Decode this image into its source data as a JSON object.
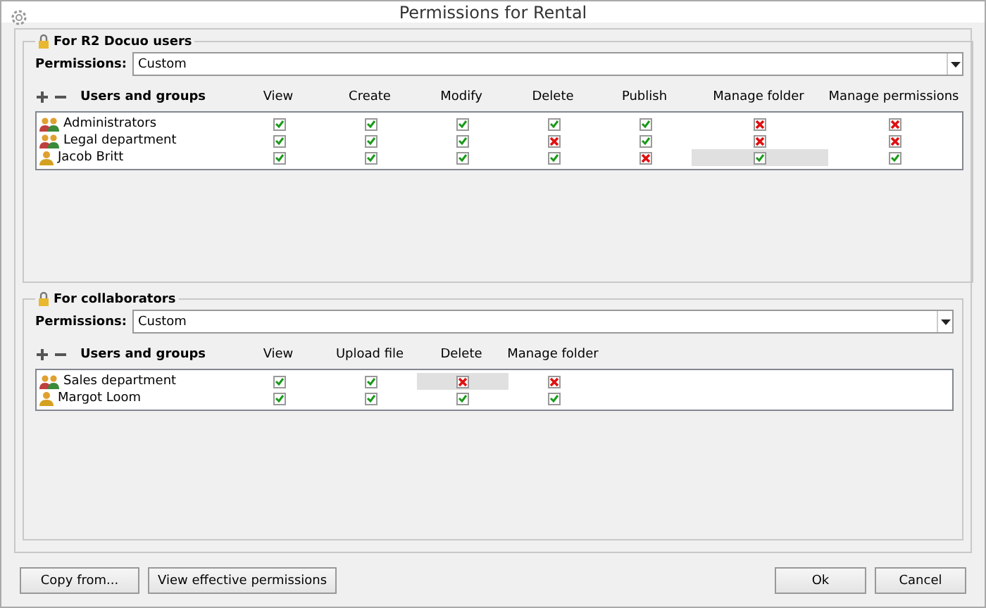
{
  "window": {
    "title": "Permissions for Rental"
  },
  "sections": [
    {
      "title": "For R2 Docuo users",
      "permissions_label": "Permissions:",
      "permissions_value": "Custom",
      "name_header": "Users and groups",
      "columns": [
        "View",
        "Create",
        "Modify",
        "Delete",
        "Publish",
        "Manage folder",
        "Manage permissions"
      ],
      "rows": [
        {
          "name": "Administrators",
          "kind": "group",
          "cells": [
            {
              "kind": "granted",
              "selected": false
            },
            {
              "kind": "granted",
              "selected": false
            },
            {
              "kind": "granted",
              "selected": false
            },
            {
              "kind": "granted",
              "selected": false
            },
            {
              "kind": "granted",
              "selected": false
            },
            {
              "kind": "denied",
              "selected": false
            },
            {
              "kind": "denied",
              "selected": false
            }
          ]
        },
        {
          "name": "Legal department",
          "kind": "group",
          "cells": [
            {
              "kind": "granted",
              "selected": false
            },
            {
              "kind": "granted",
              "selected": false
            },
            {
              "kind": "granted",
              "selected": false
            },
            {
              "kind": "denied",
              "selected": false
            },
            {
              "kind": "granted",
              "selected": false
            },
            {
              "kind": "denied",
              "selected": false
            },
            {
              "kind": "denied",
              "selected": false
            }
          ]
        },
        {
          "name": "Jacob Britt",
          "kind": "user",
          "cells": [
            {
              "kind": "granted",
              "selected": false
            },
            {
              "kind": "granted",
              "selected": false
            },
            {
              "kind": "granted",
              "selected": false
            },
            {
              "kind": "granted",
              "selected": false
            },
            {
              "kind": "denied",
              "selected": false
            },
            {
              "kind": "granted",
              "selected": true
            },
            {
              "kind": "granted",
              "selected": false
            }
          ]
        }
      ]
    },
    {
      "title": "For collaborators",
      "permissions_label": "Permissions:",
      "permissions_value": "Custom",
      "name_header": "Users and groups",
      "columns": [
        "View",
        "Upload file",
        "Delete",
        "Manage folder"
      ],
      "rows": [
        {
          "name": "Sales department",
          "kind": "group",
          "cells": [
            {
              "kind": "granted",
              "selected": false
            },
            {
              "kind": "granted",
              "selected": false
            },
            {
              "kind": "denied",
              "selected": true
            },
            {
              "kind": "denied",
              "selected": false
            }
          ]
        },
        {
          "name": "Margot Loom",
          "kind": "user",
          "cells": [
            {
              "kind": "granted",
              "selected": false
            },
            {
              "kind": "granted",
              "selected": false
            },
            {
              "kind": "granted",
              "selected": false
            },
            {
              "kind": "granted",
              "selected": false
            }
          ]
        }
      ]
    }
  ],
  "left_buttons": [
    "Copy from...",
    "View effective permissions"
  ],
  "right_buttons": [
    "Ok",
    "Cancel"
  ]
}
